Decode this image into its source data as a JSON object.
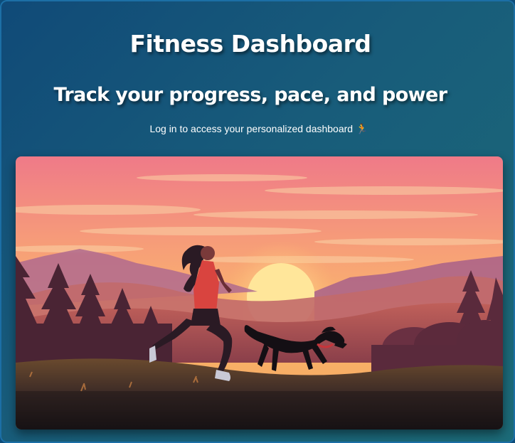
{
  "header": {
    "title": "Fitness Dashboard",
    "subtitle": "Track your progress, pace, and power",
    "tagline": "Log in to access your personalized dashboard",
    "tagline_icon": "🏃"
  },
  "hero": {
    "icon": "runner-with-dog-sunset-illustration"
  },
  "colors": {
    "background_start": "#104a78",
    "background_end": "#1c6b78",
    "text": "#ffffff",
    "sky_top": "#f07a86",
    "sky_mid": "#f9a86a",
    "sun": "#ffe79a",
    "runner_shirt": "#d9443f",
    "dog_collar": "#c8343a"
  }
}
